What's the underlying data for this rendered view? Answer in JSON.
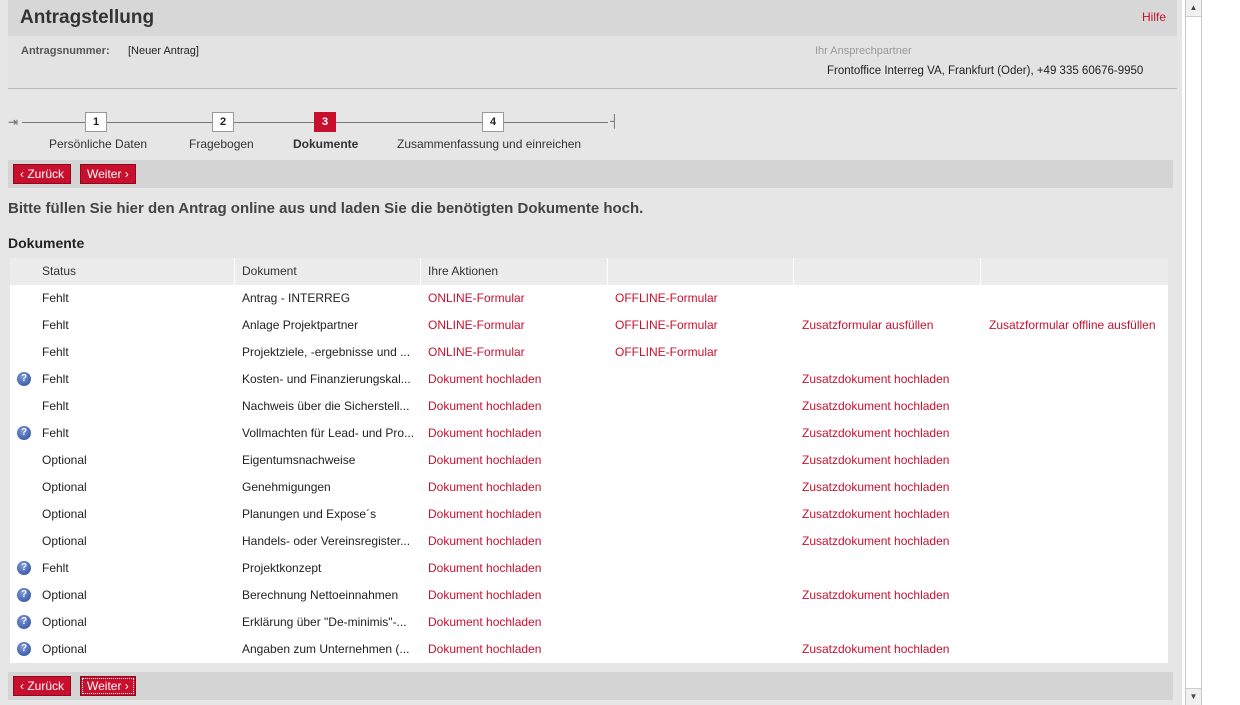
{
  "header": {
    "title": "Antragstellung",
    "help": "Hilfe",
    "number_label": "Antragsnummer:",
    "number_value": "[Neuer Antrag]",
    "contact_label": "Ihr Ansprechpartner",
    "contact_value": "Frontoffice Interreg VA, Frankfurt (Oder), +49 335 60676-9950"
  },
  "wizard": {
    "steps": [
      {
        "num": "1",
        "label": "Persönliche Daten",
        "active": false
      },
      {
        "num": "2",
        "label": "Fragebogen",
        "active": false
      },
      {
        "num": "3",
        "label": "Dokumente",
        "active": true
      },
      {
        "num": "4",
        "label": "Zusammenfassung und einreichen",
        "active": false
      }
    ]
  },
  "buttons": {
    "back": "‹ Zurück",
    "next": "Weiter ›"
  },
  "instruction": "Bitte füllen Sie hier den Antrag online aus und laden Sie die benötigten Dokumente hoch.",
  "section_title": "Dokumente",
  "table": {
    "columns": [
      "Status",
      "Dokument",
      "Ihre Aktionen"
    ],
    "rows": [
      {
        "info": false,
        "status": "Fehlt",
        "doc": "Antrag - INTERREG",
        "a1": "ONLINE-Formular",
        "a2": "OFFLINE-Formular",
        "a3": "",
        "a4": ""
      },
      {
        "info": false,
        "status": "Fehlt",
        "doc": "Anlage Projektpartner",
        "a1": "ONLINE-Formular",
        "a2": "OFFLINE-Formular",
        "a3": "Zusatzformular ausfüllen",
        "a4": "Zusatzformular offline ausfüllen"
      },
      {
        "info": false,
        "status": "Fehlt",
        "doc": "Projektziele, -ergebnisse und ...",
        "a1": "ONLINE-Formular",
        "a2": "OFFLINE-Formular",
        "a3": "",
        "a4": ""
      },
      {
        "info": true,
        "status": "Fehlt",
        "doc": "Kosten- und Finanzierungskal...",
        "a1": "Dokument hochladen",
        "a2": "",
        "a3": "Zusatzdokument hochladen",
        "a4": ""
      },
      {
        "info": false,
        "status": "Fehlt",
        "doc": "Nachweis über die Sicherstell...",
        "a1": "Dokument hochladen",
        "a2": "",
        "a3": "Zusatzdokument hochladen",
        "a4": ""
      },
      {
        "info": true,
        "status": "Fehlt",
        "doc": "Vollmachten für Lead- und Pro...",
        "a1": "Dokument hochladen",
        "a2": "",
        "a3": "Zusatzdokument hochladen",
        "a4": ""
      },
      {
        "info": false,
        "status": "Optional",
        "doc": "Eigentumsnachweise",
        "a1": "Dokument hochladen",
        "a2": "",
        "a3": "Zusatzdokument hochladen",
        "a4": ""
      },
      {
        "info": false,
        "status": "Optional",
        "doc": "Genehmigungen",
        "a1": "Dokument hochladen",
        "a2": "",
        "a3": "Zusatzdokument hochladen",
        "a4": ""
      },
      {
        "info": false,
        "status": "Optional",
        "doc": "Planungen und  Expose´s",
        "a1": "Dokument hochladen",
        "a2": "",
        "a3": "Zusatzdokument hochladen",
        "a4": ""
      },
      {
        "info": false,
        "status": "Optional",
        "doc": "Handels- oder Vereinsregister...",
        "a1": "Dokument hochladen",
        "a2": "",
        "a3": "Zusatzdokument hochladen",
        "a4": ""
      },
      {
        "info": true,
        "status": "Fehlt",
        "doc": "Projektkonzept",
        "a1": "Dokument hochladen",
        "a2": "",
        "a3": "",
        "a4": ""
      },
      {
        "info": true,
        "status": "Optional",
        "doc": "Berechnung Nettoeinnahmen",
        "a1": "Dokument hochladen",
        "a2": "",
        "a3": "Zusatzdokument hochladen",
        "a4": ""
      },
      {
        "info": true,
        "status": "Optional",
        "doc": "Erklärung über \"De-minimis\"-...",
        "a1": "Dokument hochladen",
        "a2": "",
        "a3": "",
        "a4": ""
      },
      {
        "info": true,
        "status": "Optional",
        "doc": "Angaben zum Unternehmen (...",
        "a1": "Dokument hochladen",
        "a2": "",
        "a3": "Zusatzdokument hochladen",
        "a4": ""
      }
    ]
  },
  "icons": {
    "info": "info-question-icon",
    "scroll_up": "scroll-up-arrow-icon",
    "scroll_down": "scroll-down-arrow-icon"
  },
  "colors": {
    "accent": "#c8102e"
  }
}
